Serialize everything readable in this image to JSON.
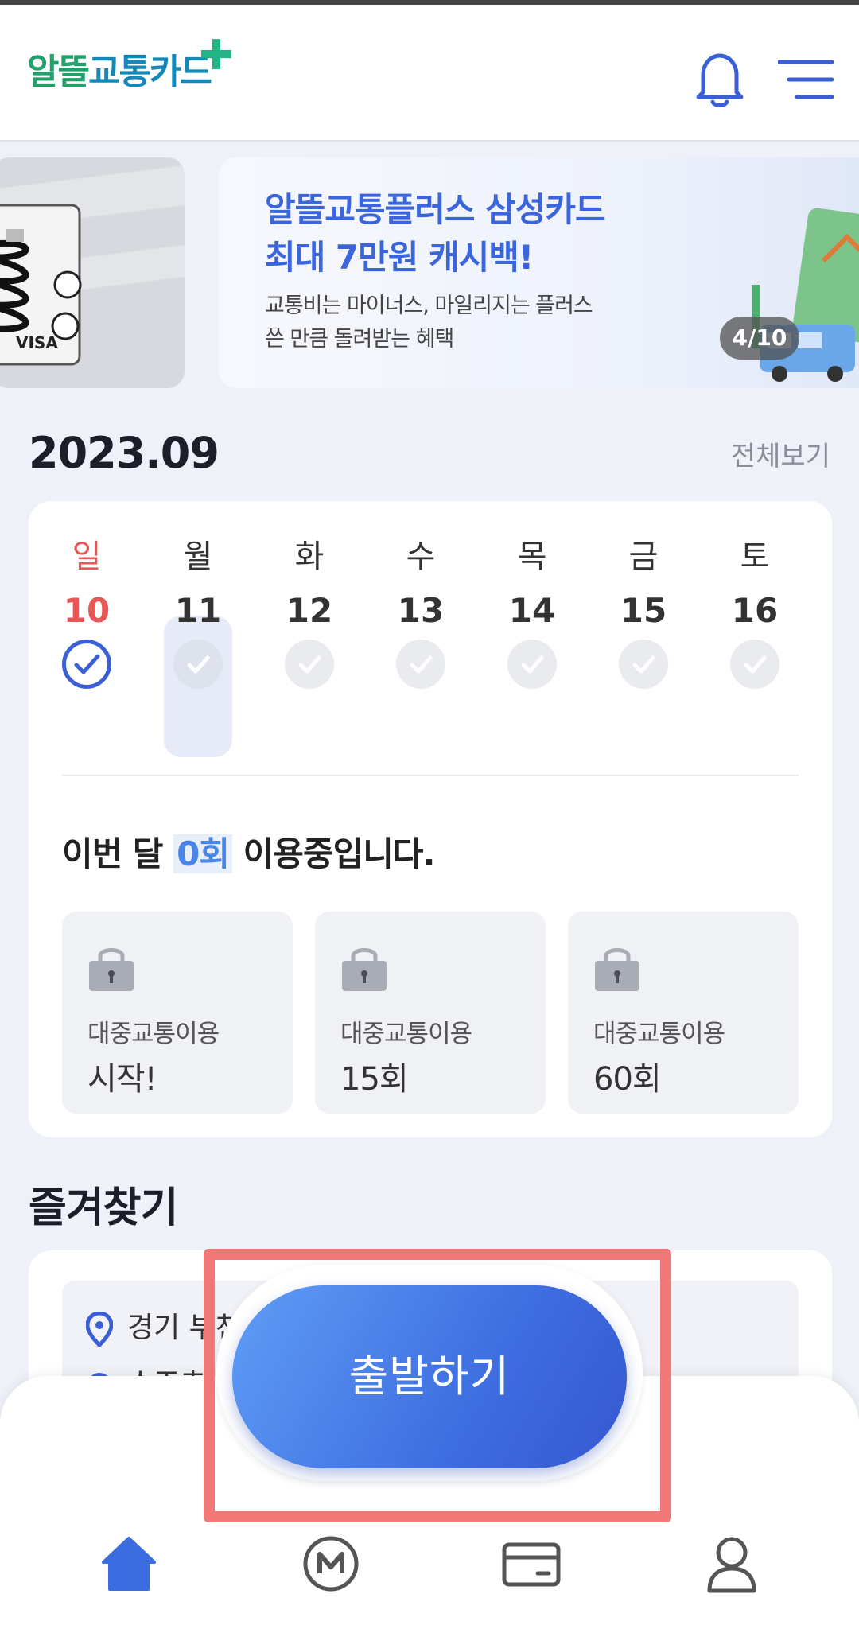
{
  "header": {
    "logo_part1": "알뜰",
    "logo_part2": "교통카드",
    "brand_colors": {
      "green": "#1fa16a",
      "teal": "#1688b8",
      "plus": "#21b487"
    }
  },
  "banner": {
    "title_line1": "알뜰교통플러스 삼성카드",
    "title_line2": "최대 7만원 캐시백!",
    "subtitle_line1": "교통비는 마이너스, 마일리지는 플러스",
    "subtitle_line2": "쓴 만큼 돌려받는 혜택",
    "counter": "4/10",
    "card_brand": "VISA"
  },
  "calendar": {
    "month": "2023.09",
    "view_all": "전체보기",
    "days": [
      {
        "name": "일",
        "num": "10",
        "checked": true
      },
      {
        "name": "월",
        "num": "11",
        "checked": false,
        "selected": true
      },
      {
        "name": "화",
        "num": "12",
        "checked": false
      },
      {
        "name": "수",
        "num": "13",
        "checked": false
      },
      {
        "name": "목",
        "num": "14",
        "checked": false
      },
      {
        "name": "금",
        "num": "15",
        "checked": false
      },
      {
        "name": "토",
        "num": "16",
        "checked": false
      }
    ],
    "usage_prefix": "이번 달 ",
    "usage_count": "0회",
    "usage_suffix": " 이용중입니다.",
    "milestones": [
      {
        "label": "대중교통이용",
        "value": "시작!"
      },
      {
        "label": "대중교통이용",
        "value": "15회"
      },
      {
        "label": "대중교통이용",
        "value": "60회"
      }
    ]
  },
  "favorites": {
    "title": "즐겨찾기",
    "origin": "경기 부천",
    "destination": "스즈츠"
  },
  "start_button": "출발하기",
  "nav": {
    "items": [
      "home-icon",
      "mileage-icon",
      "card-icon",
      "profile-icon"
    ],
    "active_color": "#3b6ce0"
  }
}
